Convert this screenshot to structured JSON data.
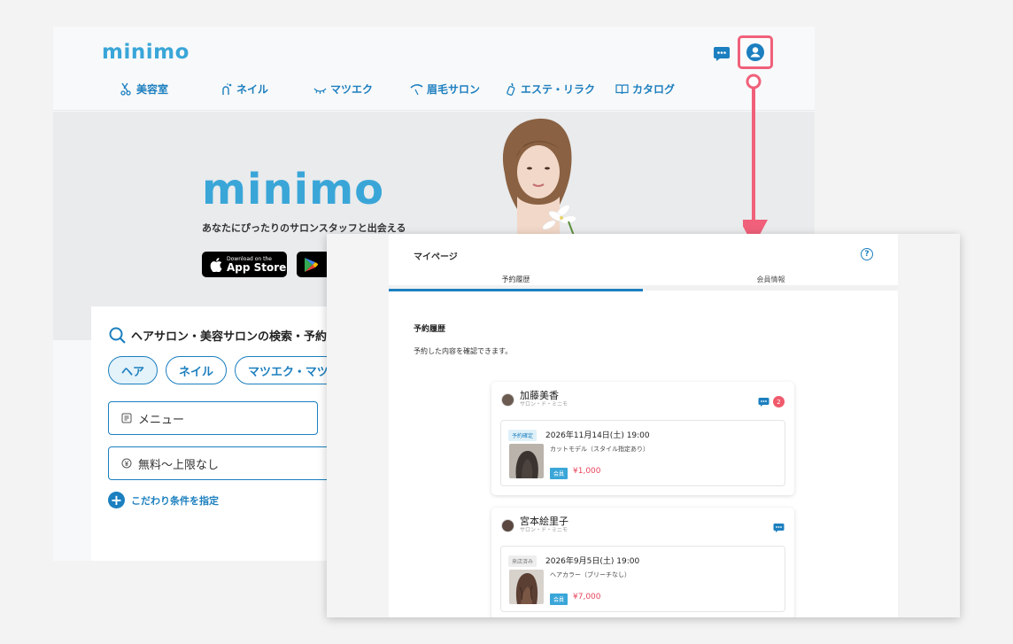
{
  "site": {
    "logo": "minimo",
    "nav": [
      {
        "label": "美容室",
        "icon": "scissors-icon"
      },
      {
        "label": "ネイル",
        "icon": "nail-icon"
      },
      {
        "label": "マツエク",
        "icon": "eyelash-icon"
      },
      {
        "label": "眉毛サロン",
        "icon": "eyebrow-icon"
      },
      {
        "label": "エステ・リラク",
        "icon": "bottle-icon"
      },
      {
        "label": "カタログ",
        "icon": "book-icon"
      }
    ],
    "hero": {
      "logo": "minimo",
      "tagline": "あなたにぴったりのサロンスタッフと出会える",
      "appstore_small": "Download on the",
      "appstore_big": "App Store"
    },
    "search": {
      "title": "ヘアサロン・美容サロンの検索・予約",
      "chips": [
        "ヘア",
        "ネイル",
        "マツエク・マツパ"
      ],
      "menu_field": "メニュー",
      "price_field": "無料〜上限なし",
      "conditions": "こだわり条件を指定"
    }
  },
  "mypage": {
    "title": "マイページ",
    "help": "?",
    "tabs": [
      "予約履歴",
      "会員情報"
    ],
    "section_title": "予約履歴",
    "description": "予約した内容を確認できます。",
    "reservations": [
      {
        "stylist": "加藤美香",
        "salon": "サロン・ド・ミニモ",
        "unread": "2",
        "status": "予約確定",
        "datetime": "2026年11月14日(土) 19:00",
        "menu": "カットモデル（スタイル指定あり）",
        "member": "会員",
        "price": "¥1,000"
      },
      {
        "stylist": "宮本絵里子",
        "salon": "サロン・ド・ミニモ",
        "status": "来店済み",
        "datetime": "2026年9月5日(土) 19:00",
        "menu": "ヘアカラー（ブリーチなし）",
        "member": "会員",
        "price": "¥7,000"
      }
    ]
  },
  "colors": {
    "brand": "#3aa6d8",
    "link": "#1c7fbf",
    "highlight": "#f0607a",
    "price": "#e8455c"
  }
}
